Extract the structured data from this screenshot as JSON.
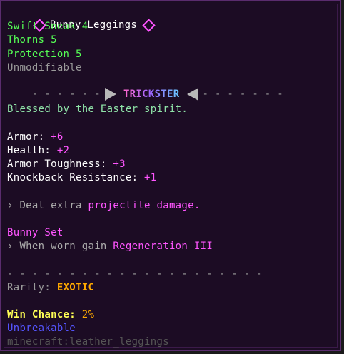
{
  "item": {
    "name": "Bunny Leggings",
    "enchants": [
      "Swift Sneak 4",
      "Thorns 5",
      "Protection 5"
    ],
    "modifiable": "Unmodifiable",
    "class_dashes_left": "- - - - - -",
    "class_name": "TRICKSTER",
    "class_dashes_right": "- - - - - - -",
    "lore": "Blessed by the Easter spirit.",
    "stats": [
      {
        "label": "Armor:",
        "value": "+6"
      },
      {
        "label": "Health:",
        "value": "+2"
      },
      {
        "label": "Armor Toughness:",
        "value": "+3"
      },
      {
        "label": "Knockback Resistance:",
        "value": "+1"
      }
    ],
    "ability": {
      "prefix": "› Deal extra ",
      "highlight": "projectile damage."
    },
    "set": {
      "name": "Bunny Set",
      "prefix": "› When worn gain ",
      "highlight": "Regeneration III"
    },
    "separator": "- - - - - - - - - - - - - - - - - - - - -",
    "rarity": {
      "label": "Rarity:",
      "value": "EXOTIC"
    },
    "win_chance": {
      "label": "Win Chance:",
      "value": "2%"
    },
    "unbreakable": "Unbreakable",
    "id": "minecraft:leather_leggings"
  },
  "colors": {
    "background": "#1c0c24",
    "border": "#5a2c6e",
    "enchant": "#55ff55",
    "accent": "#ff55ff",
    "rarity": "#ffaa00",
    "win_chance": "#ffff55",
    "unbreakable": "#5555ff"
  }
}
